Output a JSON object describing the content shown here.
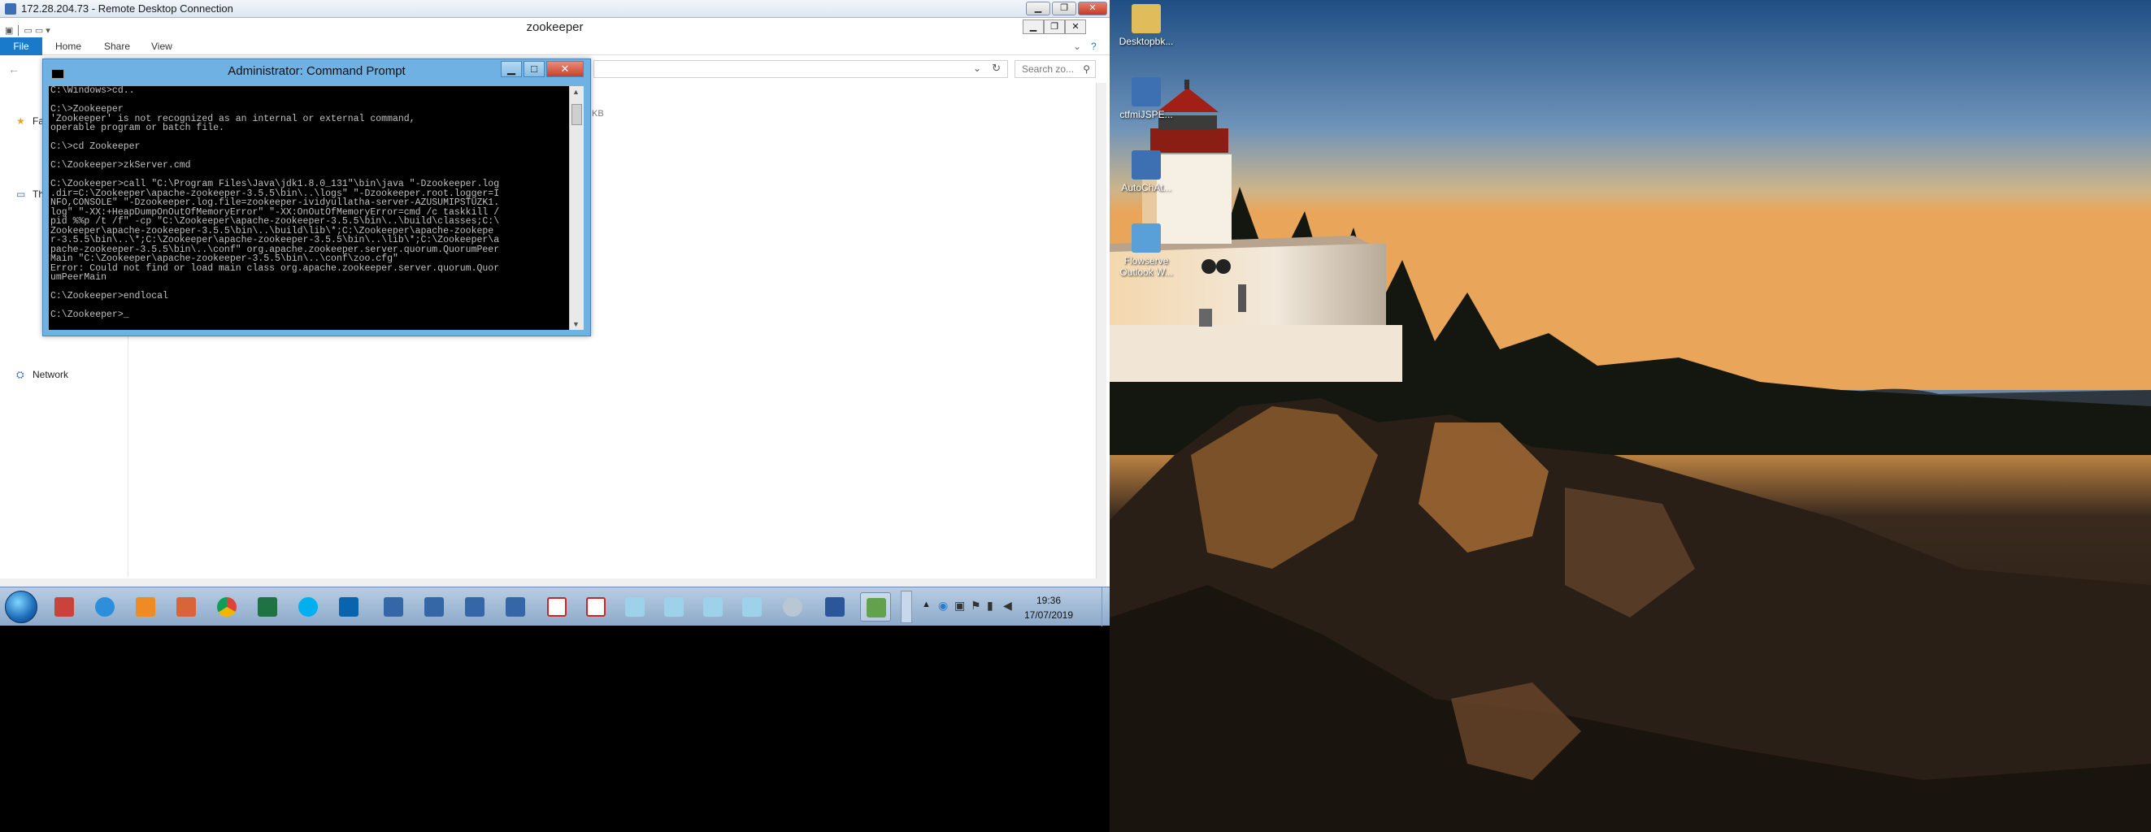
{
  "rdp": {
    "title": "172.28.204.73 - Remote Desktop Connection",
    "min_label": "▁",
    "restore_label": "❐",
    "close_label": "✕"
  },
  "explorer": {
    "title": "zookeeper",
    "tabs": {
      "file": "File",
      "home": "Home",
      "share": "Share",
      "view": "View"
    },
    "search_placeholder": "Search zo...",
    "nav": {
      "network": "Network",
      "favorites_fragment": "Fa",
      "thispc_fragment": "Th"
    },
    "kb_fragment": "KB"
  },
  "cmd": {
    "title": "Administrator: Command Prompt",
    "lines": [
      "C:\\Windows>cd..",
      "",
      "C:\\>Zookeeper",
      "'Zookeeper' is not recognized as an internal or external command,",
      "operable program or batch file.",
      "",
      "C:\\>cd Zookeeper",
      "",
      "C:\\Zookeeper>zkServer.cmd",
      "",
      "C:\\Zookeeper>call \"C:\\Program Files\\Java\\jdk1.8.0_131\"\\bin\\java \"-Dzookeeper.log",
      ".dir=C:\\Zookeeper\\apache-zookeeper-3.5.5\\bin\\..\\logs\" \"-Dzookeeper.root.logger=I",
      "NFO,CONSOLE\" \"-Dzookeeper.log.file=zookeeper-ividyullatha-server-AZUSUMIPSTUZK1.",
      "log\" \"-XX:+HeapDumpOnOutOfMemoryError\" \"-XX:OnOutOfMemoryError=cmd /c taskkill /",
      "pid %%p /t /f\" -cp \"C:\\Zookeeper\\apache-zookeeper-3.5.5\\bin\\..\\build\\classes;C:\\",
      "Zookeeper\\apache-zookeeper-3.5.5\\bin\\..\\build\\lib\\*;C:\\Zookeeper\\apache-zookepe",
      "r-3.5.5\\bin\\..\\*;C:\\Zookeeper\\apache-zookeeper-3.5.5\\bin\\..\\lib\\*;C:\\Zookeeper\\a",
      "pache-zookeeper-3.5.5\\bin\\..\\conf\" org.apache.zookeeper.server.quorum.QuorumPeer",
      "Main \"C:\\Zookeeper\\apache-zookeeper-3.5.5\\bin\\..\\conf\\zoo.cfg\"",
      "Error: Could not find or load main class org.apache.zookeeper.server.quorum.Quor",
      "umPeerMain",
      "",
      "C:\\Zookeeper>endlocal",
      "",
      "C:\\Zookeeper>_"
    ]
  },
  "taskbar": {
    "time": "19:36",
    "date": "17/07/2019"
  },
  "desktop": {
    "icons": [
      "Desktopbk...",
      "ctfmiJSPE...",
      "AutoChAt...",
      "Flowserve Outlook W..."
    ]
  },
  "colors": {
    "cmd_frame": "#6fb1e3",
    "ribbon_file": "#1979ca",
    "taskbar": "#a4bdd8"
  }
}
